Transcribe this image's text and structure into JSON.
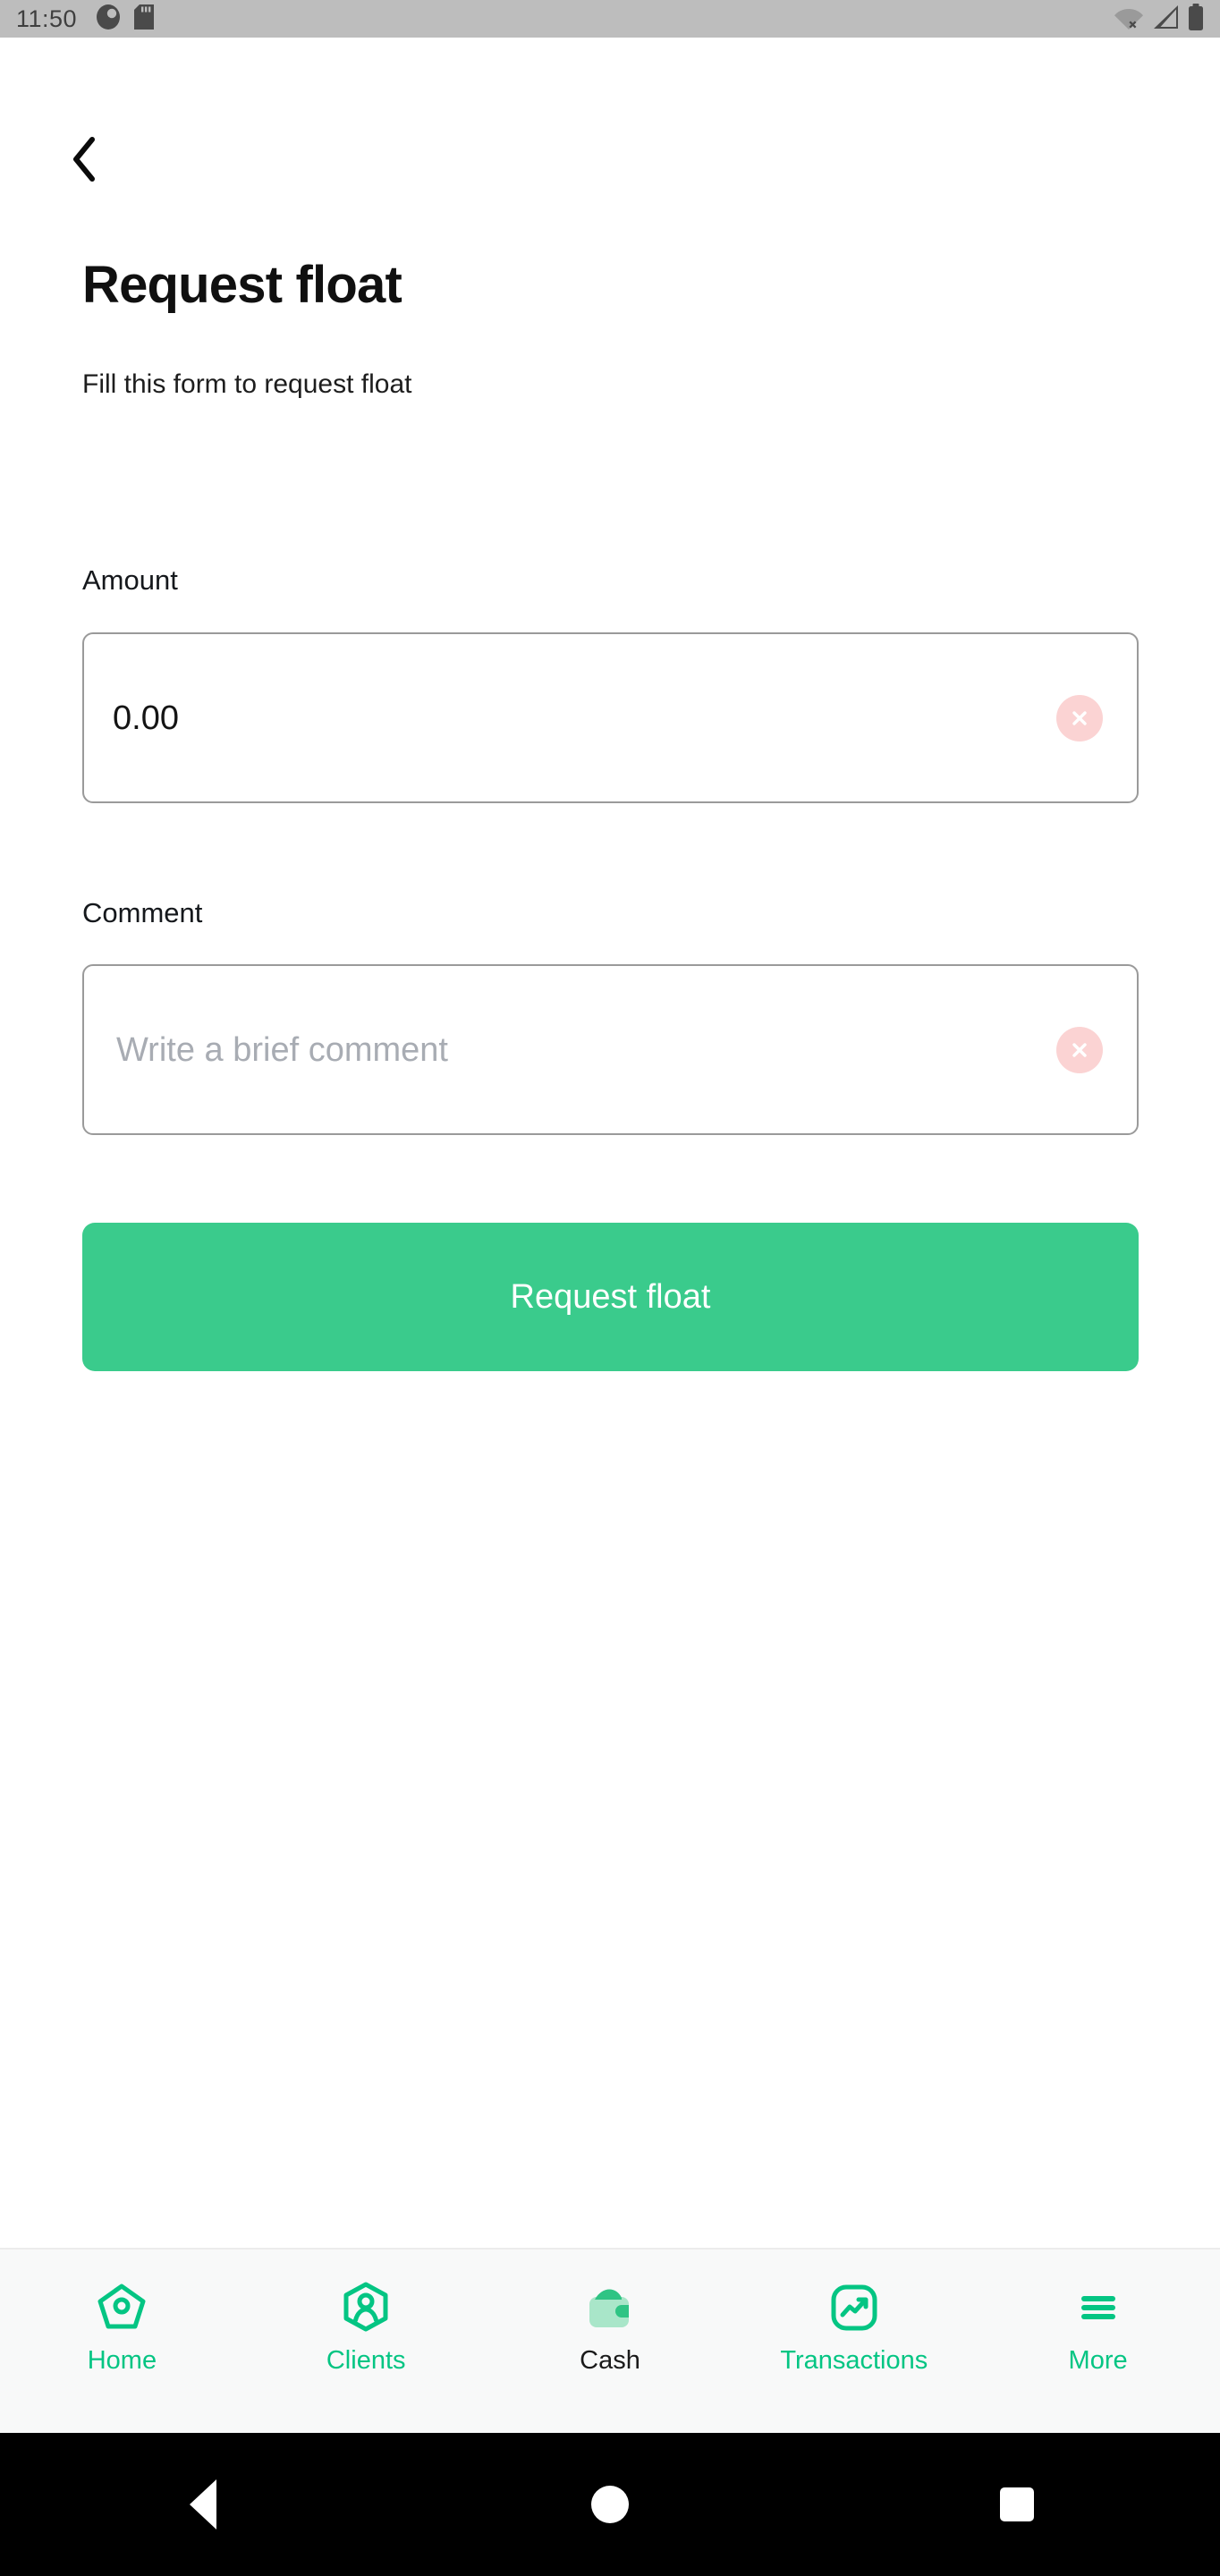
{
  "status_bar": {
    "time": "11:50",
    "left_icons": [
      "app-circle-icon",
      "sd-card-icon"
    ],
    "right_icons": [
      "wifi-off-icon",
      "cellular-signal-icon",
      "battery-icon"
    ],
    "background_color": "#bdbdbd"
  },
  "header": {
    "back_icon": "chevron-left-icon",
    "title": "Request float",
    "subtitle": "Fill this form to request float"
  },
  "form": {
    "amount": {
      "label": "Amount",
      "value": "0.00",
      "placeholder": "0.00",
      "clear_icon": "clear-circle-icon"
    },
    "comment": {
      "label": "Comment",
      "value": "",
      "placeholder": "Write a brief comment",
      "clear_icon": "clear-circle-icon"
    },
    "submit_label": "Request float"
  },
  "colors": {
    "accent_green": "#3ACB8C",
    "tab_green": "#04c583",
    "clear_pink": "#fbd3d3",
    "input_border": "#9a9a9a",
    "placeholder": "#a8acb3",
    "tabbar_bg": "#f8f9f9"
  },
  "tabbar": {
    "items": [
      {
        "label": "Home",
        "icon": "home-icon",
        "active": false
      },
      {
        "label": "Clients",
        "icon": "clients-icon",
        "active": false
      },
      {
        "label": "Cash",
        "icon": "wallet-icon",
        "active": true
      },
      {
        "label": "Transactions",
        "icon": "trending-up-icon",
        "active": false
      },
      {
        "label": "More",
        "icon": "hamburger-menu-icon",
        "active": false
      }
    ]
  },
  "android_nav": {
    "back": "android-back-icon",
    "home": "android-home-icon",
    "recents": "android-recents-icon"
  }
}
